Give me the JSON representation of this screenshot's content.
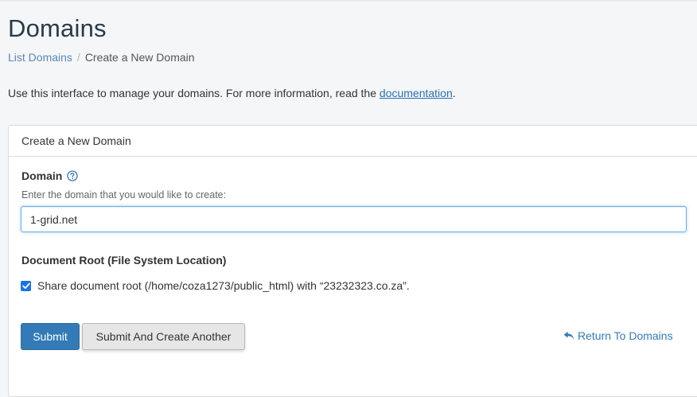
{
  "page": {
    "title": "Domains"
  },
  "breadcrumb": {
    "items": [
      {
        "label": "List Domains"
      },
      {
        "label": "Create a New Domain"
      }
    ],
    "separator": "/"
  },
  "intro": {
    "text": "Use this interface to manage your domains. For more information, read the ",
    "link_label": "documentation",
    "suffix": "."
  },
  "form": {
    "panel_title": "Create a New Domain",
    "domain_label": "Domain",
    "domain_hint": "Enter the domain that you would like to create:",
    "domain_value": "1-grid.net",
    "docroot_label": "Document Root (File System Location)",
    "share_docroot_checked": true,
    "share_docroot_label": "Share document root (/home/coza1273/public_html) with “23232323.co.za”.",
    "submit_label": "Submit",
    "submit_another_label": "Submit And Create Another",
    "return_label": "Return To Domains"
  },
  "icons": {
    "help": "question-circle-icon",
    "checkbox": "checkmark-icon",
    "return": "reply-arrow-icon"
  },
  "colors": {
    "primary": "#337ab7",
    "link": "#2a6fb0",
    "checkbox": "#1a73e8",
    "input_focus": "#66afe9"
  }
}
